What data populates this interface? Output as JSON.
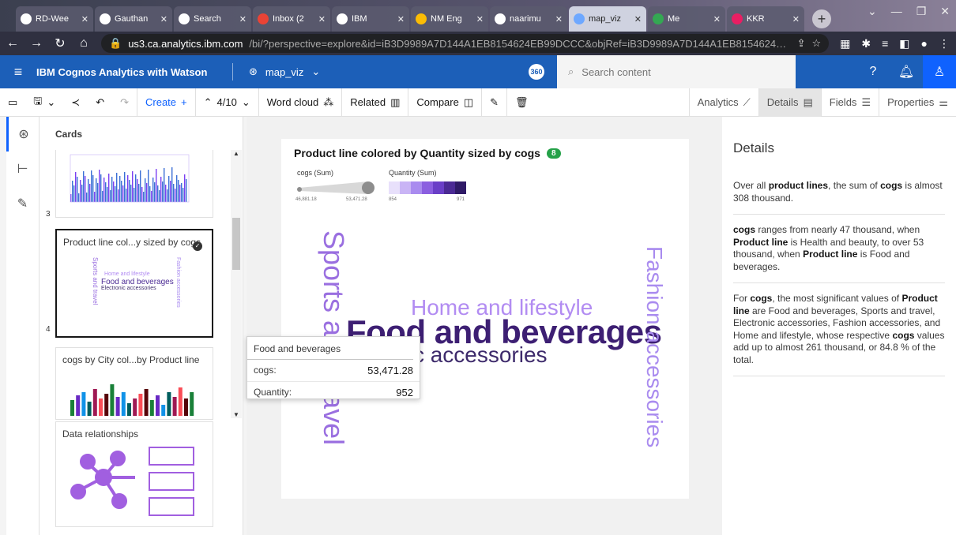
{
  "browser": {
    "tabs": [
      {
        "title": "RD-Wee"
      },
      {
        "title": "Gauthan"
      },
      {
        "title": "Search"
      },
      {
        "title": "Inbox (2"
      },
      {
        "title": "IBM"
      },
      {
        "title": "NM Eng"
      },
      {
        "title": "naarimu"
      },
      {
        "title": "map_viz"
      },
      {
        "title": "Me"
      },
      {
        "title": "KKR"
      }
    ],
    "url_host": "us3.ca.analytics.ibm.com",
    "url_rest": "/bi/?perspective=explore&id=iB3D9989A7D144A1EB8154624EB99DCCC&objRef=iB3D9989A7D144A1EB8154624EB99DCC..."
  },
  "app": {
    "brand": "IBM Cognos Analytics with Watson",
    "report_name": "map_viz",
    "badge": "360",
    "search_placeholder": "Search content"
  },
  "toolbar": {
    "create": "Create",
    "page": "4/10",
    "word_cloud": "Word cloud",
    "related": "Related",
    "compare": "Compare",
    "analytics": "Analytics",
    "details": "Details",
    "fields": "Fields",
    "properties": "Properties"
  },
  "cards": {
    "title": "Cards",
    "items": [
      {
        "num": "3",
        "title": ""
      },
      {
        "num": "4",
        "title": "Product line col...y sized by cogs"
      },
      {
        "num": "",
        "title": "cogs by City col...by Product line"
      },
      {
        "num": "",
        "title": "Data relationships"
      }
    ],
    "mini_words": [
      "Home and lifestyle",
      "Food and beverages",
      "Electronic accessories",
      "Sports and travel",
      "Fashion accessories"
    ]
  },
  "viz": {
    "title": "Product line colored by Quantity sized by cogs",
    "count": "8",
    "legend_size_label": "cogs (Sum)",
    "legend_size_min": "46,881.18",
    "legend_size_max": "53,471.28",
    "legend_color_label": "Quantity (Sum)",
    "legend_color_min": "854",
    "legend_color_max": "971",
    "palette": [
      "#e8e0fb",
      "#c9b4f5",
      "#a98bef",
      "#8b5fe0",
      "#6a3fc7",
      "#4b2a94",
      "#2f1a66"
    ]
  },
  "chart_data": {
    "type": "word_cloud",
    "title": "Product line colored by Quantity sized by cogs",
    "words": [
      {
        "text": "Food and beverages",
        "cogs": 53471.28,
        "quantity": 952,
        "color": "#3d1f73"
      },
      {
        "text": "Sports and travel",
        "color": "#9a6fe0"
      },
      {
        "text": "Fashion accessories",
        "color": "#a98bef"
      },
      {
        "text": "Home and lifestyle",
        "color": "#b28cf2"
      },
      {
        "text": "Electronic accessories",
        "color": "#3d2a6b"
      }
    ],
    "size_legend": {
      "label": "cogs (Sum)",
      "min": 46881.18,
      "max": 53471.28
    },
    "color_legend": {
      "label": "Quantity (Sum)",
      "min": 854,
      "max": 971
    }
  },
  "tooltip": {
    "title": "Food and beverages",
    "rows": [
      {
        "label": "cogs:",
        "value": "53,471.28"
      },
      {
        "label": "Quantity:",
        "value": "952"
      }
    ]
  },
  "details": {
    "title": "Details",
    "p1_a": "Over all ",
    "p1_b": "product lines",
    "p1_c": ", the sum of ",
    "p1_d": "cogs",
    "p1_e": " is almost 308 thousand.",
    "p2_a": "cogs",
    "p2_b": " ranges from nearly 47 thousand, when ",
    "p2_c": "Product line",
    "p2_d": " is Health and beauty, to over 53 thousand, when ",
    "p2_e": "Product line",
    "p2_f": " is Food and beverages.",
    "p3_a": "For ",
    "p3_b": "cogs",
    "p3_c": ", the most significant values of ",
    "p3_d": "Product line",
    "p3_e": " are Food and beverages, Sports and travel, Electronic accessories, Fashion accessories, and Home and lifestyle, whose respective ",
    "p3_f": "cogs",
    "p3_g": " values add up to almost 261 thousand, or 84.8 % of the total."
  }
}
